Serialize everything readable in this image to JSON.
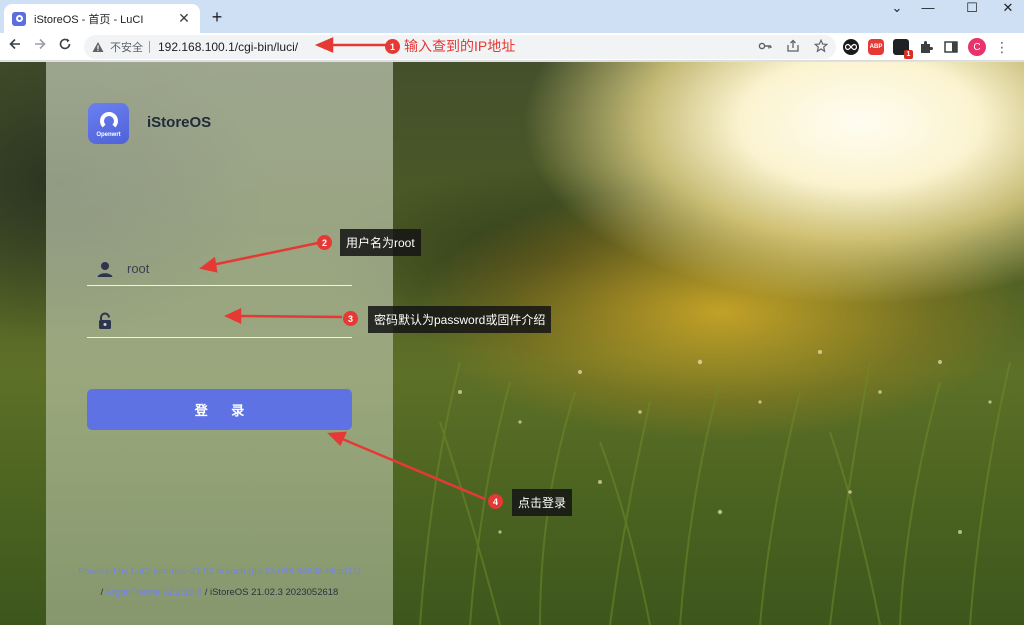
{
  "browser": {
    "tab_title": "iStoreOS - 首页 - LuCI",
    "tab_close": "✕",
    "new_tab": "+",
    "window_controls": [
      "⌄",
      "—",
      "☐",
      "✕"
    ],
    "insecure_label": "不安全",
    "url": "192.168.100.1/cgi-bin/luci/",
    "profile_letter": "C",
    "ext_badge": "1",
    "ext_abp": "ABP",
    "menu": "⋮"
  },
  "login": {
    "brand": "iStoreOS",
    "logo_caption": "Openwrt",
    "username_value": "root",
    "password_value": "",
    "submit_label": "登 录",
    "accent": "#5e72e4"
  },
  "footer": {
    "line1": "Powered by LuCI istoreos-21.02 branch (git-23.088.34636-f8cc111)",
    "line2_prefix": "/ ",
    "line2_link": "ArgonTheme v2.2.10.8",
    "line2_suffix": " / iStoreOS 21.02.3 2023052618"
  },
  "annotations": [
    {
      "number": "1",
      "text": "输入查到的IP地址"
    },
    {
      "number": "2",
      "text": "用户名为root"
    },
    {
      "number": "3",
      "text": "密码默认为password或固件介绍"
    },
    {
      "number": "4",
      "text": "点击登录"
    }
  ]
}
